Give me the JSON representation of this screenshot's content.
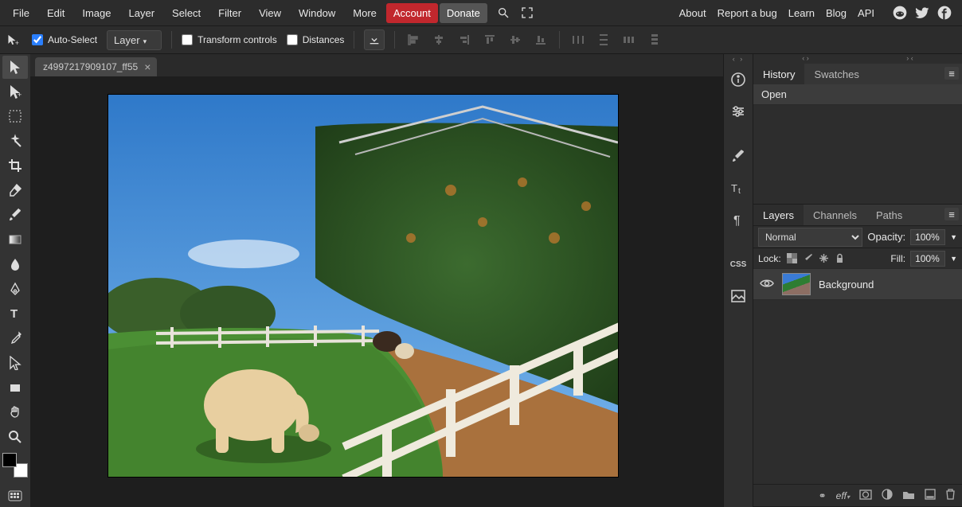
{
  "menu": {
    "items": [
      "File",
      "Edit",
      "Image",
      "Layer",
      "Select",
      "Filter",
      "View",
      "Window",
      "More"
    ],
    "account": "Account",
    "donate": "Donate"
  },
  "toplinks": [
    "About",
    "Report a bug",
    "Learn",
    "Blog",
    "API"
  ],
  "options": {
    "autoSelect": "Auto-Select",
    "layerSel": "Layer",
    "transform": "Transform controls",
    "distances": "Distances"
  },
  "doc": {
    "tabName": "z4997217909107_ff55"
  },
  "panels": {
    "history": {
      "tabs": [
        "History",
        "Swatches"
      ],
      "rows": [
        "Open"
      ]
    },
    "layers": {
      "tabs": [
        "Layers",
        "Channels",
        "Paths"
      ],
      "blend": "Normal",
      "opacityLabel": "Opacity:",
      "opacityVal": "100%",
      "lockLabel": "Lock:",
      "fillLabel": "Fill:",
      "fillVal": "100%",
      "items": [
        {
          "name": "Background"
        }
      ],
      "footer": [
        "∞",
        "eff,",
        "▢",
        "◐",
        "▣",
        "◧",
        "🗑"
      ]
    }
  },
  "sideIcons": [
    "info-icon",
    "adjust-icon",
    "brush-panel-icon",
    "type-panel-icon",
    "paragraph-panel-icon",
    "css-panel-icon",
    "image-panel-icon"
  ],
  "tools": [
    "move",
    "artboard",
    "marquee",
    "wand",
    "crop",
    "eraser",
    "brush",
    "gradient",
    "blur",
    "pen",
    "type",
    "eyedropper",
    "path-select",
    "shape",
    "hand",
    "zoom"
  ]
}
